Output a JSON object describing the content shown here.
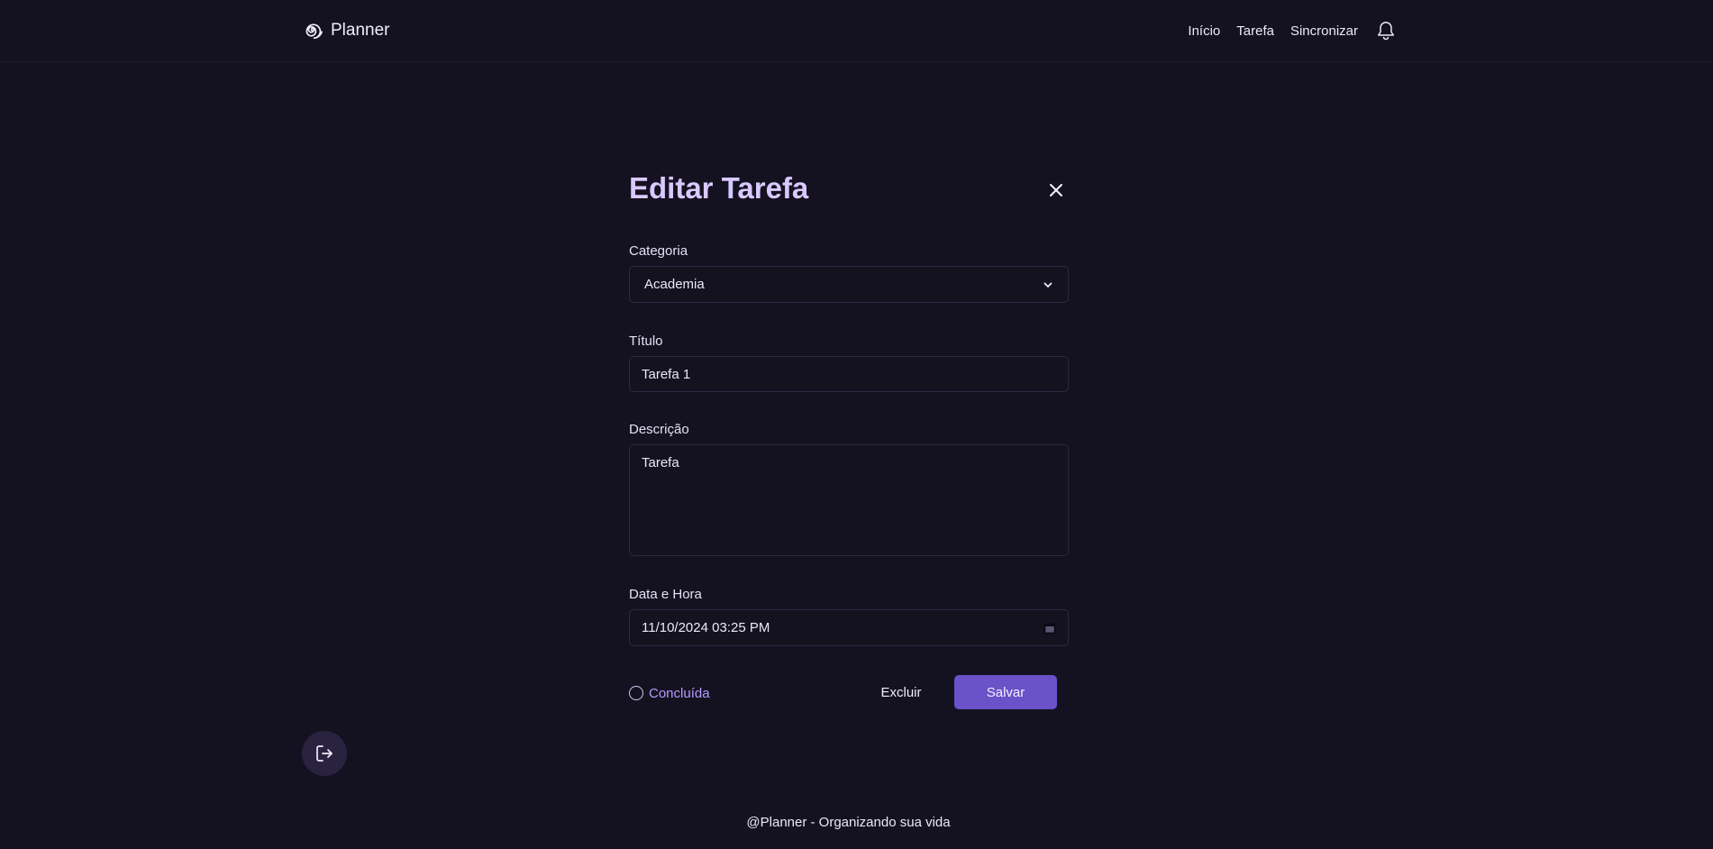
{
  "app": {
    "name": "Planner",
    "logo_icon": "spiral-logo-icon"
  },
  "nav": {
    "items": [
      {
        "label": "Início"
      },
      {
        "label": "Tarefa"
      },
      {
        "label": "Sincronizar"
      }
    ],
    "notification_icon": "bell-icon"
  },
  "form": {
    "title": "Editar Tarefa",
    "close_icon": "close-icon",
    "category": {
      "label": "Categoria",
      "value": "Academia"
    },
    "title_field": {
      "label": "Título",
      "value": "Tarefa 1"
    },
    "description": {
      "label": "Descrição",
      "value": "Tarefa"
    },
    "datetime": {
      "label": "Data e Hora",
      "value": "11/10/2024 03:25 PM"
    },
    "completed": {
      "label": "Concluída",
      "checked": false
    },
    "delete_label": "Excluir",
    "save_label": "Salvar"
  },
  "logout_icon": "logout-icon",
  "footer": {
    "text": "@Planner - Organizando sua vida"
  },
  "colors": {
    "background": "#141221",
    "title": "#d8c9ff",
    "accent": "#6a52c9",
    "done_label": "#b89bff"
  }
}
